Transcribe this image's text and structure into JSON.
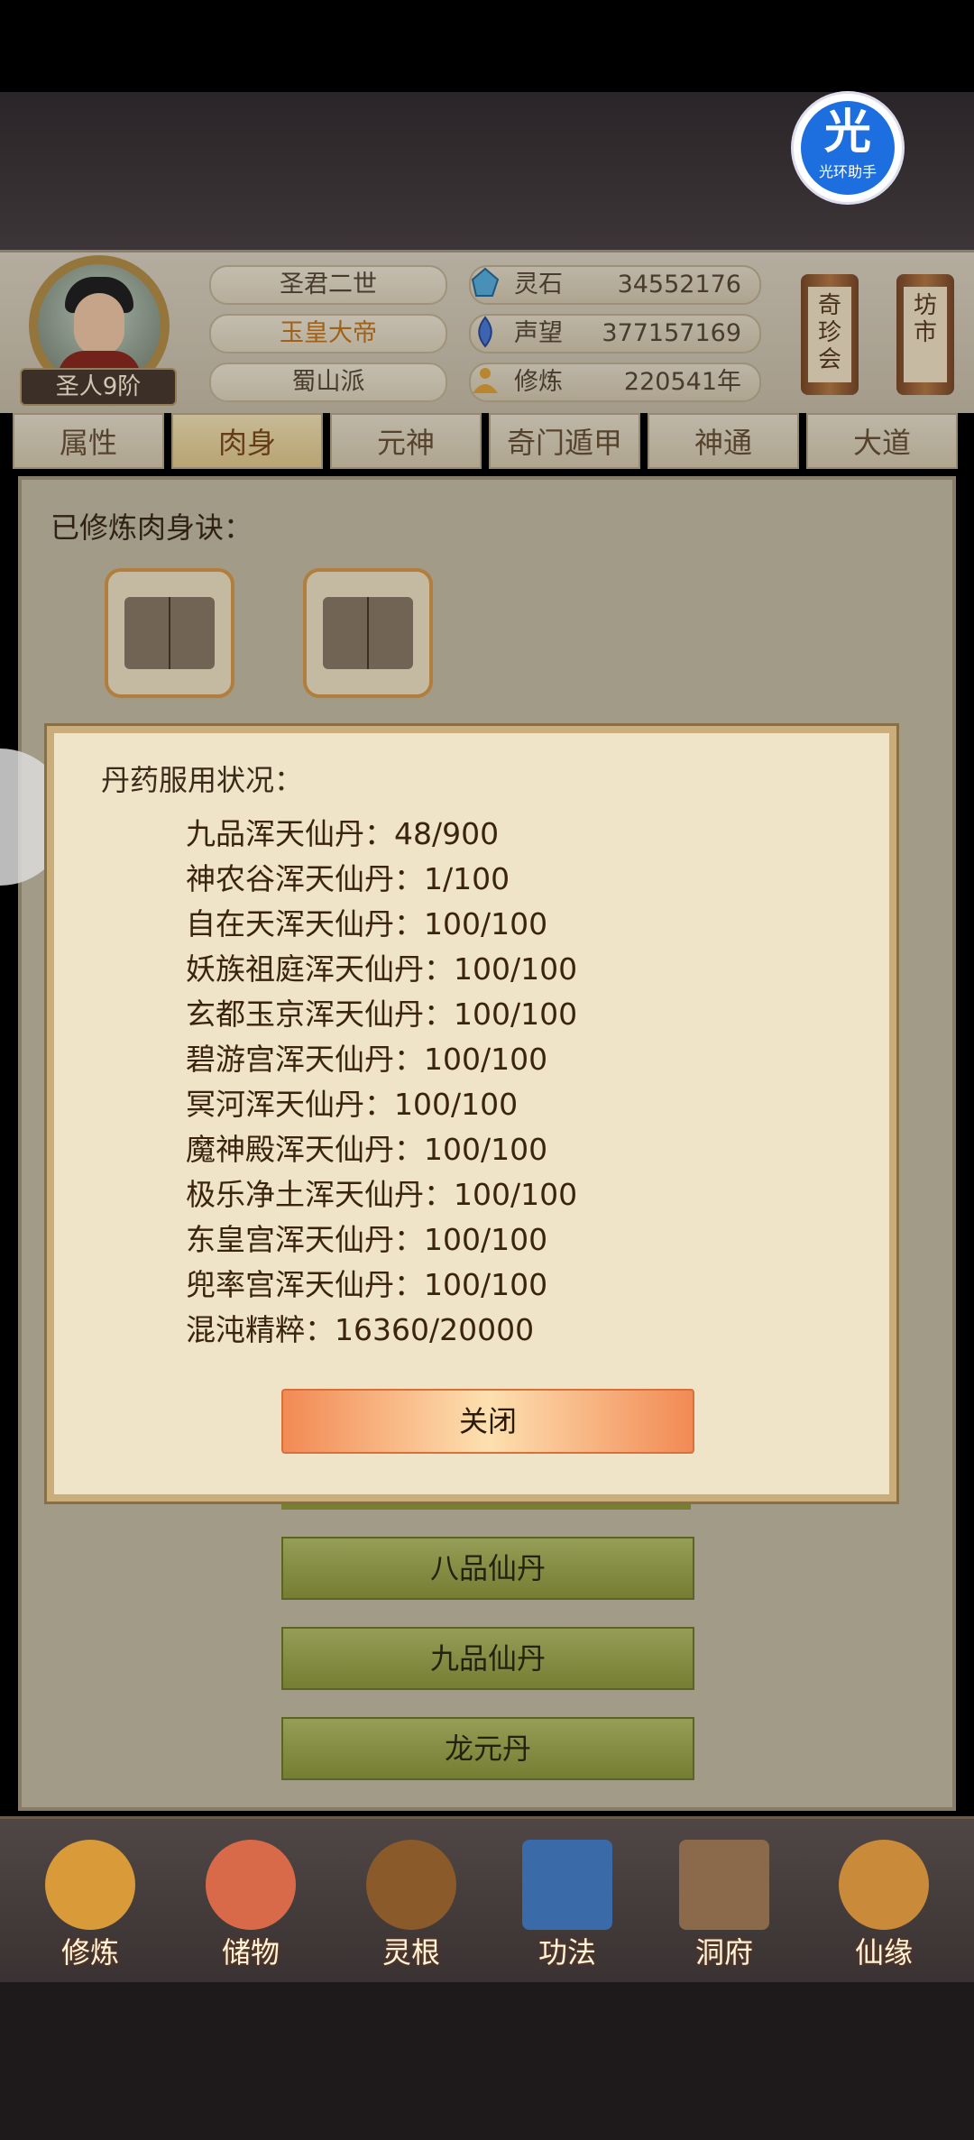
{
  "helper": {
    "glyph": "光",
    "label": "光环助手"
  },
  "player": {
    "title": "圣君二世",
    "rank_title": "玉皇大帝",
    "sect": "蜀山派",
    "realm": "圣人9阶"
  },
  "resources": [
    {
      "icon": "spirit-stone-icon",
      "label": "灵石",
      "value": "34552176"
    },
    {
      "icon": "reputation-icon",
      "label": "声望",
      "value": "377157169"
    },
    {
      "icon": "cultivation-icon",
      "label": "修炼",
      "value": "220541年"
    }
  ],
  "side_scrolls": [
    {
      "label": "奇珍会"
    },
    {
      "label": "坊市"
    }
  ],
  "tabs": [
    {
      "label": "属性",
      "active": false
    },
    {
      "label": "肉身",
      "active": true
    },
    {
      "label": "元神",
      "active": false
    },
    {
      "label": "奇门遁甲",
      "active": false
    },
    {
      "label": "神通",
      "active": false
    },
    {
      "label": "大道",
      "active": false
    }
  ],
  "panel": {
    "cultivated_label": "已修炼肉身诀：",
    "books": [
      {
        "icon": "book-icon"
      },
      {
        "icon": "book-icon"
      }
    ]
  },
  "dialog": {
    "title": "丹药服用状况：",
    "rows": [
      "九品浑天仙丹：48/900",
      "神农谷浑天仙丹：1/100",
      "自在天浑天仙丹：100/100",
      "妖族祖庭浑天仙丹：100/100",
      "玄都玉京浑天仙丹：100/100",
      "碧游宫浑天仙丹：100/100",
      "冥河浑天仙丹：100/100",
      "魔神殿浑天仙丹：100/100",
      "极乐净土浑天仙丹：100/100",
      "东皇宫浑天仙丹：100/100",
      "兜率宫浑天仙丹：100/100",
      "混沌精粹：16360/20000"
    ],
    "close_label": "关闭"
  },
  "pill_buttons": [
    {
      "label": "八品仙丹"
    },
    {
      "label": "九品仙丹"
    },
    {
      "label": "龙元丹"
    }
  ],
  "bottom_nav": [
    {
      "label": "修炼",
      "icon": "meditation-icon",
      "color": "#d99a3a"
    },
    {
      "label": "储物",
      "icon": "storage-bag-icon",
      "color": "#d86a4a"
    },
    {
      "label": "灵根",
      "icon": "spirit-root-icon",
      "color": "#8a5a2a"
    },
    {
      "label": "功法",
      "icon": "technique-book-icon",
      "color": "#3a6aa8"
    },
    {
      "label": "洞府",
      "icon": "cave-house-icon",
      "color": "#8a6a4a"
    },
    {
      "label": "仙缘",
      "icon": "gourd-icon",
      "color": "#c98a3a"
    }
  ]
}
